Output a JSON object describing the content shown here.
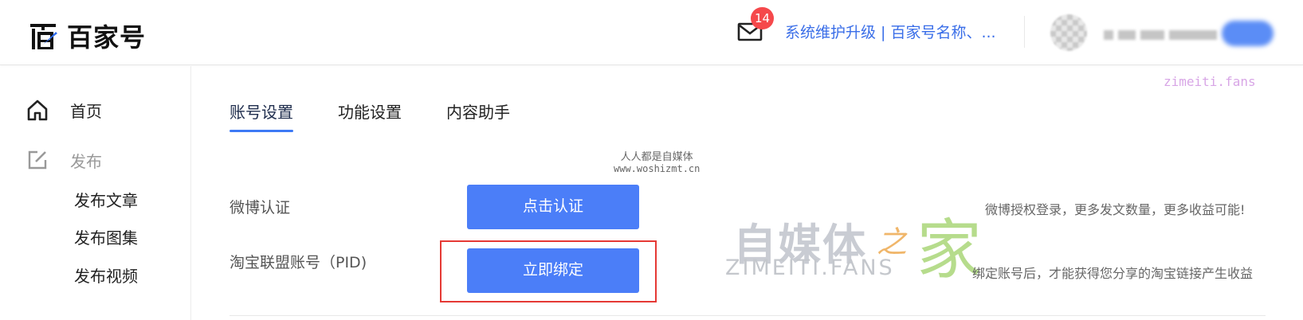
{
  "header": {
    "logo_text": "百家号",
    "mail_badge": "14",
    "notice": "系统维护升级 | 百家号名称、..."
  },
  "watermarks": {
    "top_right": "zimeiti.fans",
    "center_line1": "人人都是自媒体",
    "center_line2": "www.woshizmt.cn",
    "big_cn1": "自媒体",
    "big_cn2": "之",
    "big_cn3": "家",
    "big_en": "ZIMEITI.FANS"
  },
  "sidebar": {
    "home": "首页",
    "publish": "发布",
    "sub_items": [
      "发布文章",
      "发布图集",
      "发布视频"
    ]
  },
  "tabs": [
    "账号设置",
    "功能设置",
    "内容助手"
  ],
  "rows": [
    {
      "label": "微博认证",
      "button": "点击认证",
      "hint": "微博授权登录，更多发文数量，更多收益可能!"
    },
    {
      "label": "淘宝联盟账号（PID)",
      "button": "立即绑定",
      "hint": "绑定账号后，才能获得您分享的淘宝链接产生收益"
    }
  ],
  "colors": {
    "accent": "#4b7ef8",
    "notice_link": "#3a6ee8",
    "badge": "#f5484b",
    "highlight_box": "#e53935"
  }
}
